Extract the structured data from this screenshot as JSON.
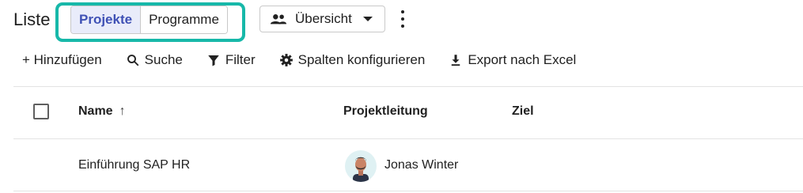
{
  "page": {
    "title": "Liste"
  },
  "toggle": {
    "options": [
      "Projekte",
      "Programme"
    ],
    "selected": "Projekte"
  },
  "view_select": {
    "label": "Übersicht",
    "icon": "people-icon"
  },
  "toolbar": {
    "add": "+ Hinzufügen",
    "search": "Suche",
    "filter": "Filter",
    "columns": "Spalten konfigurieren",
    "export": "Export nach Excel"
  },
  "table": {
    "columns": [
      "Name",
      "Projektleitung",
      "Ziel"
    ],
    "sort_indicator": "↑",
    "rows": [
      {
        "name": "Einführung SAP HR",
        "lead": "Jonas Winter",
        "goal": ""
      }
    ]
  },
  "colors": {
    "highlight": "#17b8a9",
    "accent": "#3f51b5",
    "selected_bg": "#e9ecfa"
  }
}
